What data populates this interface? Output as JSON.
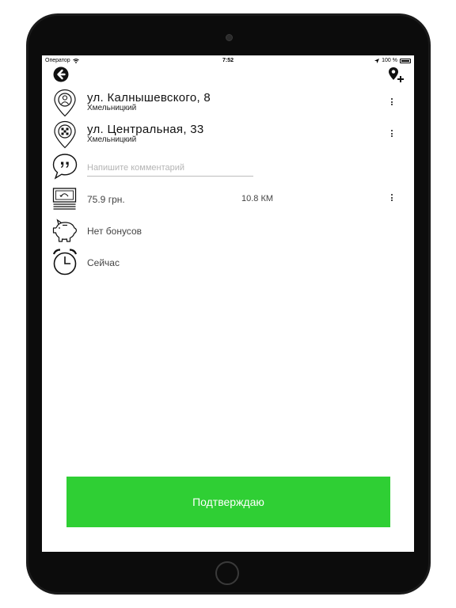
{
  "status_bar": {
    "carrier": "Оператор",
    "time": "7:52",
    "battery": "100 %"
  },
  "route": {
    "from": {
      "street": "ул. Калнышевского, 8",
      "city": "Хмельницкий"
    },
    "to": {
      "street": "ул. Центральная, 33",
      "city": "Хмельницкий"
    }
  },
  "comment": {
    "placeholder": "Напишите комментарий"
  },
  "fare": {
    "price": "75.9 грн.",
    "distance": "10.8 КМ"
  },
  "bonus": {
    "text": "Нет бонусов"
  },
  "time_option": {
    "text": "Сейчас"
  },
  "confirm_button": {
    "label": "Подтверждаю"
  },
  "colors": {
    "accent": "#2fcf34",
    "text": "#111111"
  }
}
